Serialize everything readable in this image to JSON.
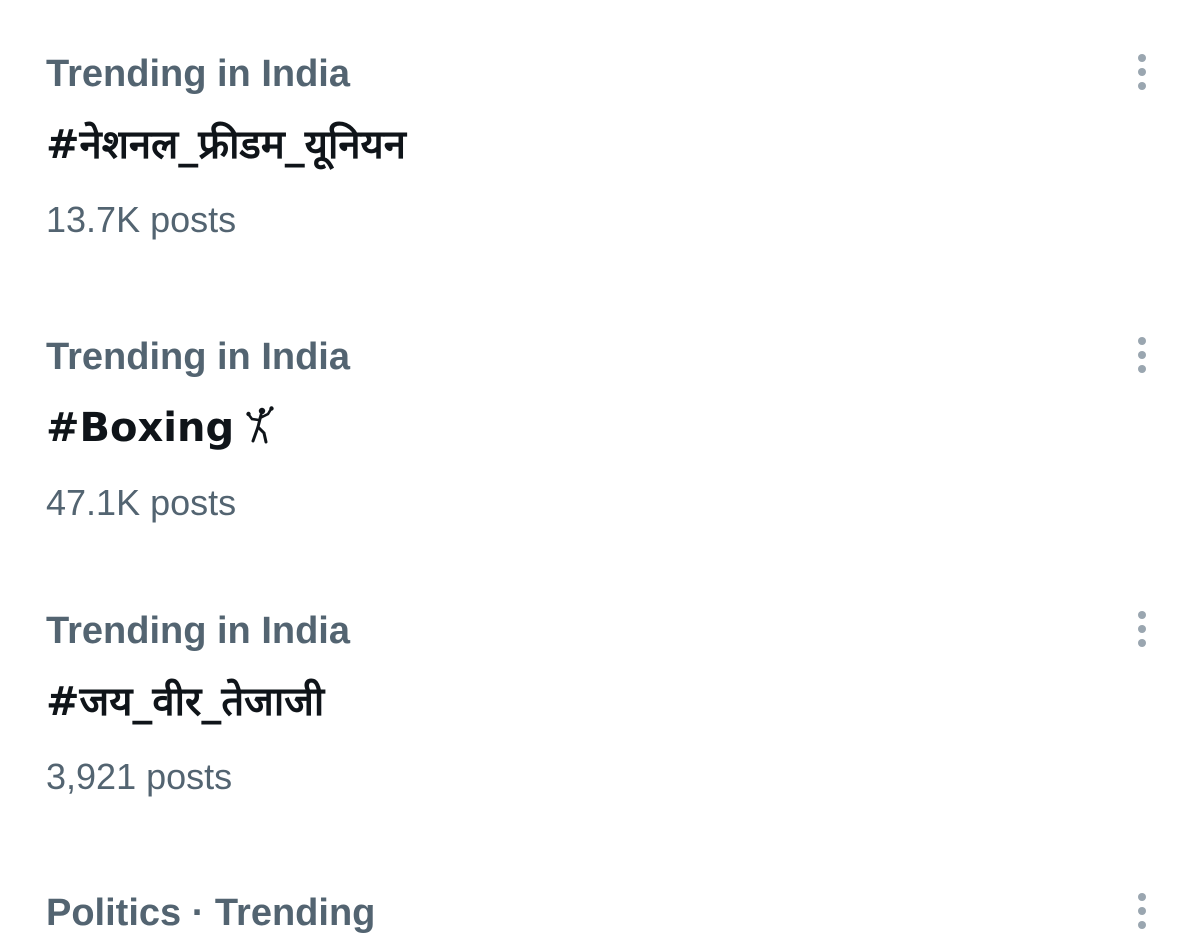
{
  "trends": [
    {
      "context": "Trending in India",
      "topic": "#नेशनल_फ्रीडम_यूनियन",
      "count": "13.7K posts",
      "icon": "more-vertical-icon"
    },
    {
      "context": "Trending in India",
      "topic": "#Boxing",
      "topic_emoji": "boxer-icon",
      "count": "47.1K posts",
      "icon": "more-vertical-icon"
    },
    {
      "context": "Trending in India",
      "topic": "#जय_वीर_तेजाजी",
      "count": "3,921 posts",
      "icon": "more-vertical-icon"
    },
    {
      "context": "Politics · Trending",
      "icon": "more-vertical-icon"
    }
  ],
  "colors": {
    "secondary_text": "#536471",
    "primary_text": "#0f1419",
    "icon": "#9aa6b0",
    "background": "#ffffff"
  }
}
